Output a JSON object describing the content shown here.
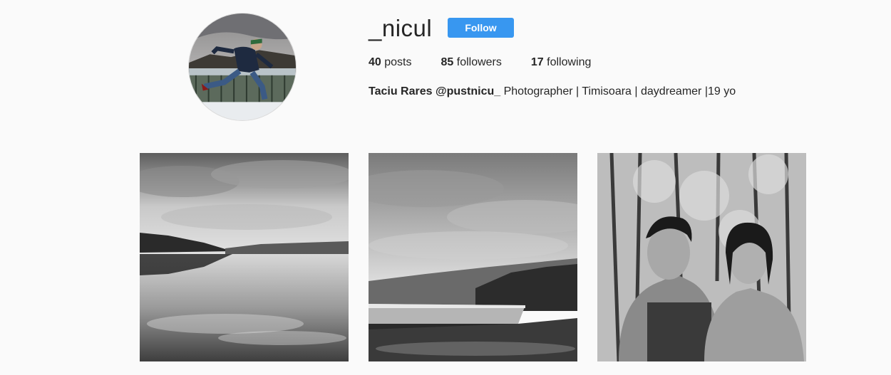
{
  "profile": {
    "username": "_nicul",
    "follow_label": "Follow",
    "avatar_icon": "profile-photo"
  },
  "stats": {
    "posts_count": "40",
    "posts_label": "posts",
    "followers_count": "85",
    "followers_label": "followers",
    "following_count": "17",
    "following_label": "following"
  },
  "bio": {
    "name": "Taciu Rares @pustnicu_",
    "text": "Photographer | Timisoara | daydreamer |19 yo"
  },
  "posts": [
    {
      "subject": "lake-landscape"
    },
    {
      "subject": "dam-and-hills"
    },
    {
      "subject": "couple-in-forest"
    }
  ],
  "colors": {
    "accent": "#3897f0",
    "background": "#fafafa",
    "text": "#262626"
  }
}
